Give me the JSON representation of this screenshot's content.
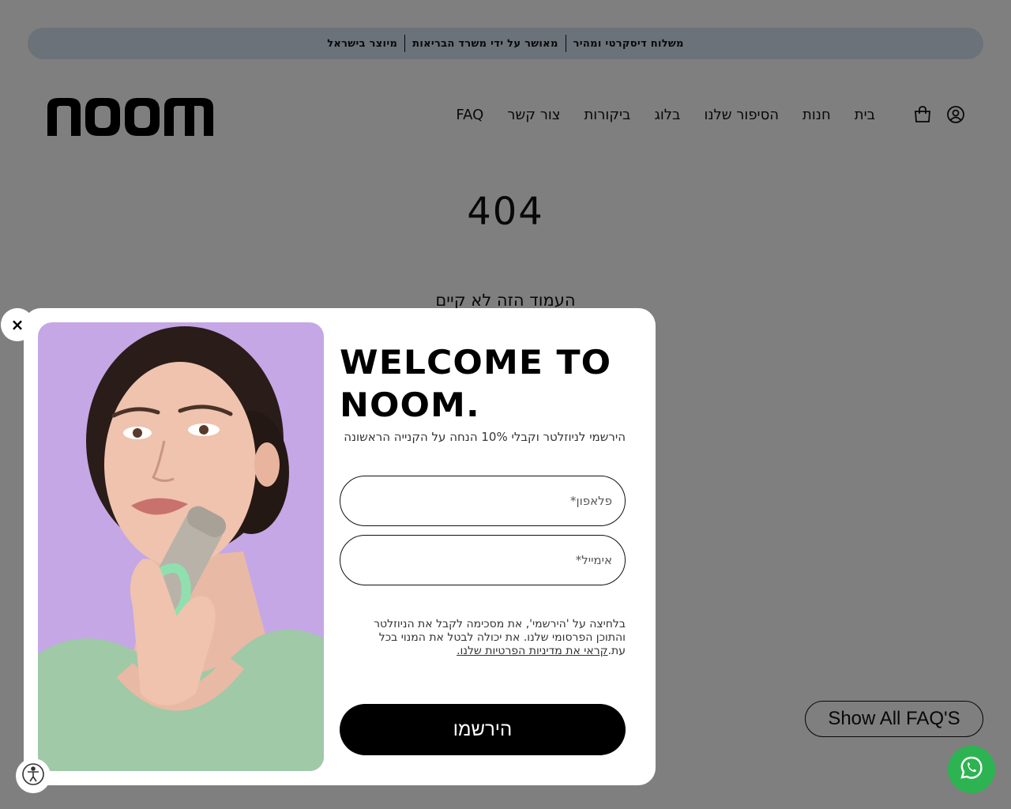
{
  "announcement": {
    "items": [
      "משלוח דיסקרטי ומהיר",
      "מאושר על ידי משרד הבריאות",
      "מיוצר בישראל"
    ]
  },
  "header": {
    "logo_text": "NOOM",
    "nav": [
      "בית",
      "חנות",
      "הסיפור שלנו",
      "בלוג",
      "ביקורות",
      "צור קשר",
      "FAQ"
    ],
    "icons": [
      "account-icon",
      "cart-icon"
    ]
  },
  "error": {
    "code": "404",
    "message": "העמוד הזה לא קיים"
  },
  "faq_button": "Show All FAQ'S",
  "popup": {
    "close_label": "×",
    "title": "WELCOME TO NOOM.",
    "subtitle": "הירשמי לניוזלטר וקבלי 10% הנחה על הקנייה הראשונה",
    "phone_placeholder": "פלאפון*",
    "email_placeholder": "אימייל*",
    "consent_text": "בלחיצה על 'הירשמי', את מסכימה לקבל את הניוזלטר והתוכן הפרסומי שלנו. את יכולה לבטל את המנוי בכל עת.",
    "privacy_link": "קראי את מדיניות הפרטיות שלנו.",
    "submit_label": "הירשמו"
  },
  "widgets": {
    "accessibility_icon": "accessibility-icon",
    "whatsapp_icon": "whatsapp-icon"
  },
  "colors": {
    "announcement_bg": "#d7e4f2",
    "image_bg": "#c5a7e6",
    "whatsapp": "#2eb352",
    "overlay": "rgba(0,0,0,0.5)"
  }
}
